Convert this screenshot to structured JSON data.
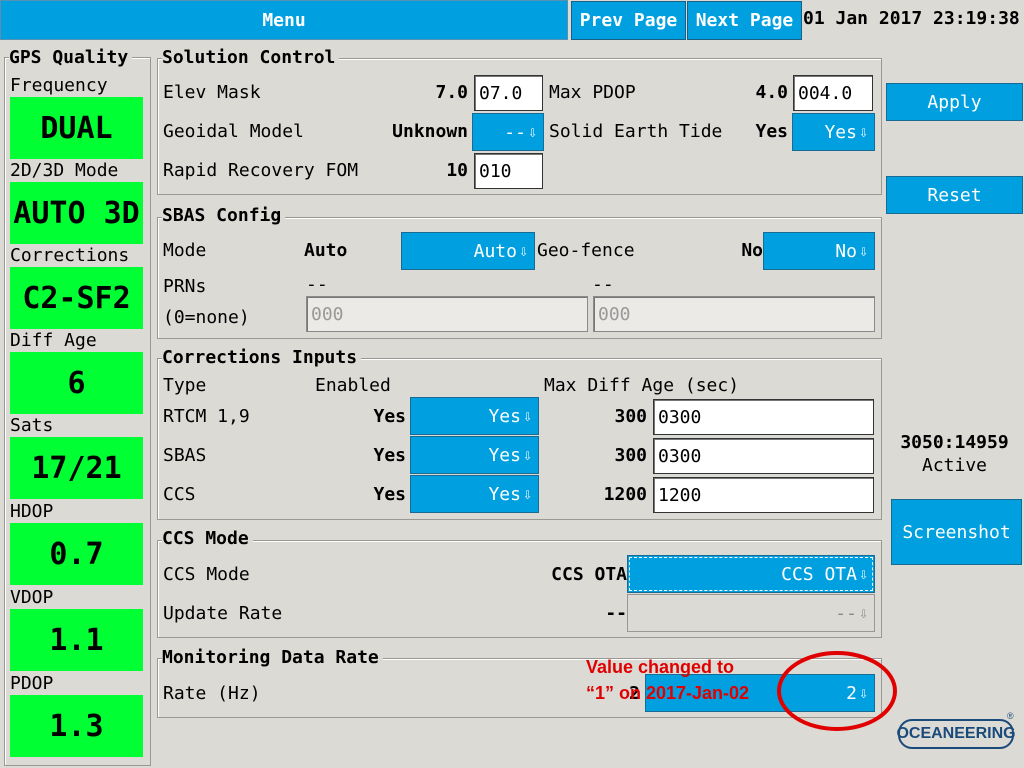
{
  "header": {
    "menu_label": "Menu",
    "prev_page_label": "Prev Page",
    "next_page_label": "Next Page",
    "datetime": "01 Jan 2017 23:19:38"
  },
  "gps_quality": {
    "title": "GPS Quality",
    "items": [
      {
        "label": "Frequency",
        "value": "DUAL"
      },
      {
        "label": "2D/3D Mode",
        "value": "AUTO 3D"
      },
      {
        "label": "Corrections",
        "value": "C2-SF2"
      },
      {
        "label": "Diff Age",
        "value": "6"
      },
      {
        "label": "Sats",
        "value": "17/21"
      },
      {
        "label": "HDOP",
        "value": "0.7"
      },
      {
        "label": "VDOP",
        "value": "1.1"
      },
      {
        "label": "PDOP",
        "value": "1.3"
      }
    ],
    "status_color": "#00ff33"
  },
  "solution_control": {
    "title": "Solution Control",
    "elev_mask": {
      "label": "Elev Mask",
      "current": "7.0",
      "input": "07.0"
    },
    "max_pdop": {
      "label": "Max PDOP",
      "current": "4.0",
      "input": "004.0"
    },
    "geoidal_model": {
      "label": "Geoidal Model",
      "current": "Unknown",
      "selected": "--"
    },
    "solid_earth_tide": {
      "label": "Solid Earth Tide",
      "current": "Yes",
      "selected": "Yes"
    },
    "rapid_recovery": {
      "label": "Rapid Recovery FOM",
      "current": "10",
      "input": "010"
    }
  },
  "sbas_config": {
    "title": "SBAS Config",
    "mode": {
      "label": "Mode",
      "current": "Auto",
      "selected": "Auto"
    },
    "geo_fence": {
      "label": "Geo-fence",
      "current": "No",
      "selected": "No"
    },
    "prns_label": "PRNs",
    "prns_sub_label": "(0=none)",
    "prn1": {
      "current": "--",
      "input": "000"
    },
    "prn2": {
      "current": "--",
      "input": "000"
    }
  },
  "corrections_inputs": {
    "title": "Corrections Inputs",
    "col_type": "Type",
    "col_enabled": "Enabled",
    "col_max_age": "Max Diff Age (sec)",
    "rows": [
      {
        "type": "RTCM 1,9",
        "enabled": "Yes",
        "selected": "Yes",
        "age_current": "300",
        "age_input": "0300"
      },
      {
        "type": "SBAS",
        "enabled": "Yes",
        "selected": "Yes",
        "age_current": "300",
        "age_input": "0300"
      },
      {
        "type": "CCS",
        "enabled": "Yes",
        "selected": "Yes",
        "age_current": "1200",
        "age_input": "1200"
      }
    ]
  },
  "ccs_mode": {
    "title": "CCS Mode",
    "mode": {
      "label": "CCS Mode",
      "current": "CCS OTA",
      "selected": "CCS OTA"
    },
    "update_rate": {
      "label": "Update Rate",
      "current": "--",
      "selected": "--"
    }
  },
  "monitoring": {
    "title": "Monitoring Data Rate",
    "rate": {
      "label": "Rate (Hz)",
      "current": "2",
      "selected": "2"
    }
  },
  "right_panel": {
    "apply_label": "Apply",
    "reset_label": "Reset",
    "status_code": "3050:14959",
    "status_text": "Active",
    "screenshot_label": "Screenshot"
  },
  "annotation": {
    "line1": "Value changed to",
    "line2": "“1” on 2017-Jan-02",
    "color": "#e00000"
  },
  "logo": {
    "text": "OCEANEERING",
    "mark": "®"
  },
  "icons": {
    "dropdown_arrow": "download-arrow-icon"
  },
  "colors": {
    "accent": "#00a0e0",
    "background": "#dcdad5",
    "good": "#00ff33"
  }
}
